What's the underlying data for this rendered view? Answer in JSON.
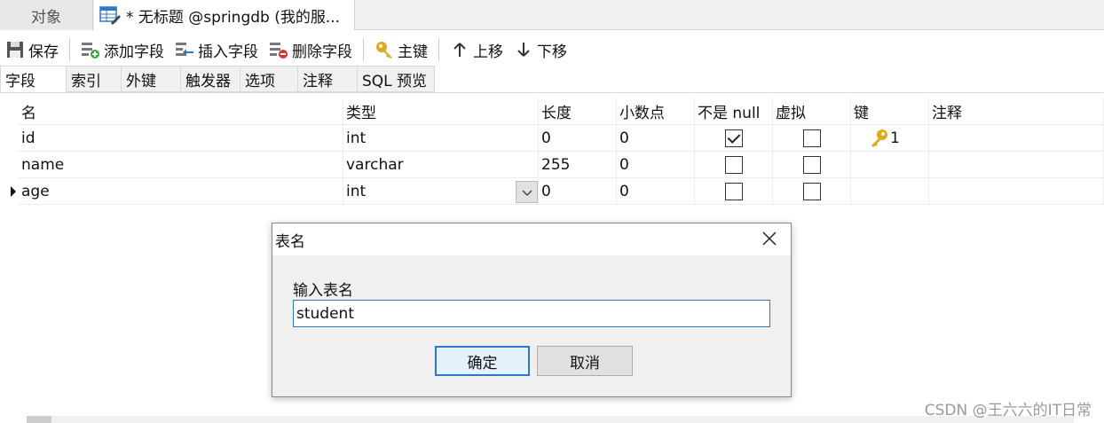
{
  "doc_tabs": {
    "objects_label": "对象",
    "active_label": "* 无标题 @springdb (我的服..."
  },
  "toolbar": {
    "save": "保存",
    "add_field": "添加字段",
    "insert_field": "插入字段",
    "delete_field": "删除字段",
    "primary_key": "主键",
    "move_up": "上移",
    "move_down": "下移"
  },
  "sub_tabs": [
    "字段",
    "索引",
    "外键",
    "触发器",
    "选项",
    "注释",
    "SQL 预览"
  ],
  "columns": [
    "名",
    "类型",
    "长度",
    "小数点",
    "不是 null",
    "虚拟",
    "键",
    "注释"
  ],
  "rows": [
    {
      "name": "id",
      "type": "int",
      "length": "0",
      "decimals": "0",
      "not_null": true,
      "virtual": false,
      "key": "1"
    },
    {
      "name": "name",
      "type": "varchar",
      "length": "255",
      "decimals": "0",
      "not_null": false,
      "virtual": false,
      "key": ""
    },
    {
      "name": "age",
      "type": "int",
      "length": "0",
      "decimals": "0",
      "not_null": false,
      "virtual": false,
      "key": ""
    }
  ],
  "dialog": {
    "title": "表名",
    "label": "输入表名",
    "input_value": "student",
    "ok": "确定",
    "cancel": "取消"
  },
  "watermark": "CSDN @王六六的IT日常",
  "colors": {
    "accent": "#2b78c6",
    "key_gold": "#e0a81c"
  }
}
